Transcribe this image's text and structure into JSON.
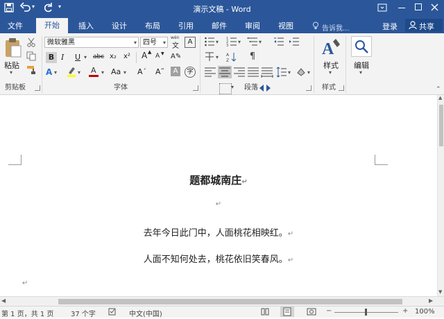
{
  "app": {
    "title": "演示文稿 - Word",
    "title_color": "#2b579a",
    "qat": {
      "save_icon": "save-icon",
      "undo_icon": "undo-icon",
      "redo_icon": "repeat-icon"
    },
    "window_controls": {
      "ribbon_opts": "ribbon-display-icon",
      "minimize": "minimize-icon",
      "restore": "restore-icon",
      "close": "close-icon"
    }
  },
  "tabs": [
    {
      "label": "文件"
    },
    {
      "label": "开始",
      "active": true
    },
    {
      "label": "插入"
    },
    {
      "label": "设计"
    },
    {
      "label": "布局"
    },
    {
      "label": "引用"
    },
    {
      "label": "邮件"
    },
    {
      "label": "审阅"
    },
    {
      "label": "视图"
    }
  ],
  "tell_me": {
    "placeholder": "告诉我..."
  },
  "account": {
    "login": "登录",
    "share": "共享"
  },
  "ribbon": {
    "clipboard": {
      "paste_label": "粘贴",
      "group_label": "剪贴板"
    },
    "font": {
      "font_name": "微软雅黑",
      "font_size": "四号",
      "wen_label": "wén",
      "bold": "B",
      "italic": "I",
      "underline": "U",
      "strike": "abc",
      "subscript": "x₂",
      "superscript": "x²",
      "grow": "A",
      "shrink": "A",
      "aa": "Aa",
      "group_label": "字体",
      "font_color": "#c00000",
      "highlight_color": "#ffff00"
    },
    "paragraph": {
      "group_label": "段落"
    },
    "styles": {
      "styles_label": "样式",
      "group_label": "样式"
    },
    "editing": {
      "edit_label": "编辑"
    }
  },
  "document": {
    "title": "题都城南庄",
    "lines": [
      "去年今日此门中，人面桃花相映红。",
      "人面不知何处去，桃花依旧笑春风。"
    ],
    "para_mark": "↵"
  },
  "status": {
    "page": "第 1 页，共 1 页",
    "words": "37 个字",
    "language": "中文(中国)",
    "zoom": "100%"
  }
}
